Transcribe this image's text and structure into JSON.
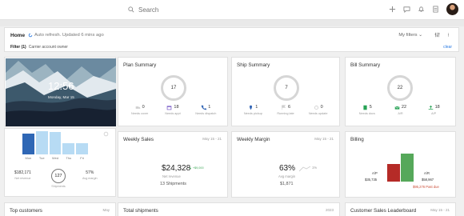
{
  "search": {
    "placeholder": "Search"
  },
  "topbar": {
    "icons": [
      "plus-icon",
      "chat-icon",
      "bell-icon",
      "document-icon",
      "avatar"
    ]
  },
  "toolbar": {
    "home_label": "Home",
    "refresh_text": "Auto refresh. Updated 6 mins ago",
    "my_filters": "My filters ⌄",
    "filter_label": "Filter (1)",
    "filter_value": "Carrier account owner",
    "clear_label": "clear"
  },
  "cards": {
    "clock": {
      "time": "12:56",
      "date": "Monday, Mar 15"
    },
    "bars": {
      "days": [
        "Mon",
        "Tue",
        "Wed",
        "Thu",
        "Fri"
      ],
      "values": [
        0.78,
        0.87,
        0.84,
        0.42,
        0.43
      ],
      "selected": "Mon",
      "net_revenue": "$182,171",
      "net_revenue_label": "Net revenue",
      "shipments": "127",
      "shipments_label": "Shipments",
      "avg_margin": "57%",
      "avg_margin_label": "Avg margin"
    },
    "plan": {
      "title": "Plan Summary",
      "count": "17",
      "stats": [
        {
          "icon": "truck-icon",
          "value": "0",
          "label": "Needs cover"
        },
        {
          "icon": "calendar-icon",
          "value": "18",
          "label": "Needs appt"
        },
        {
          "icon": "phone-icon",
          "value": "1",
          "label": "Needs dispatch"
        }
      ]
    },
    "ship": {
      "title": "Ship Summary",
      "count": "7",
      "stats": [
        {
          "icon": "map-pin-icon",
          "value": "1",
          "label": "Needs pickup"
        },
        {
          "icon": "flag-icon",
          "value": "6",
          "label": "Running late"
        },
        {
          "icon": "refresh-icon",
          "value": "0",
          "label": "Needs update"
        }
      ]
    },
    "bill": {
      "title": "Bill Summary",
      "count": "22",
      "stats": [
        {
          "icon": "document-icon",
          "value": "5",
          "label": "Needs docs"
        },
        {
          "icon": "inbox-icon",
          "value": "22",
          "label": "A/R"
        },
        {
          "icon": "outbox-icon",
          "value": "18",
          "label": "A/P"
        }
      ]
    },
    "weekly_sales": {
      "title": "Weekly Sales",
      "date": "May 15 - 21",
      "amount": "$24,328",
      "change": "▲ +$9,000",
      "amount_label": "Net revenue",
      "shipments": "13 Shipments"
    },
    "weekly_margin": {
      "title": "Weekly Margin",
      "date": "May 15 - 21",
      "percent": "63%",
      "change": "1%",
      "percent_label": "Avg margin",
      "amount": "$1,871"
    },
    "billing": {
      "title": "Billing",
      "ap_label": "A/P",
      "ap_value": "$35,735",
      "ar_label": "A/R",
      "ar_value": "$58,967",
      "past_due": "$95,276 Past due",
      "ap_color": "#b52b27",
      "ar_color": "#56a85a"
    },
    "top_customers": {
      "title": "Top customers",
      "date": "May"
    },
    "total_shipments": {
      "title": "Total shipments",
      "date": "2023"
    },
    "leaderboard": {
      "title": "Customer Sales Leaderboard",
      "date": "May 15 - 21"
    }
  },
  "colors": {
    "accent": "#2a7ae2",
    "selected_bar": "#2f67b5",
    "bar": "#b7dbf4"
  }
}
